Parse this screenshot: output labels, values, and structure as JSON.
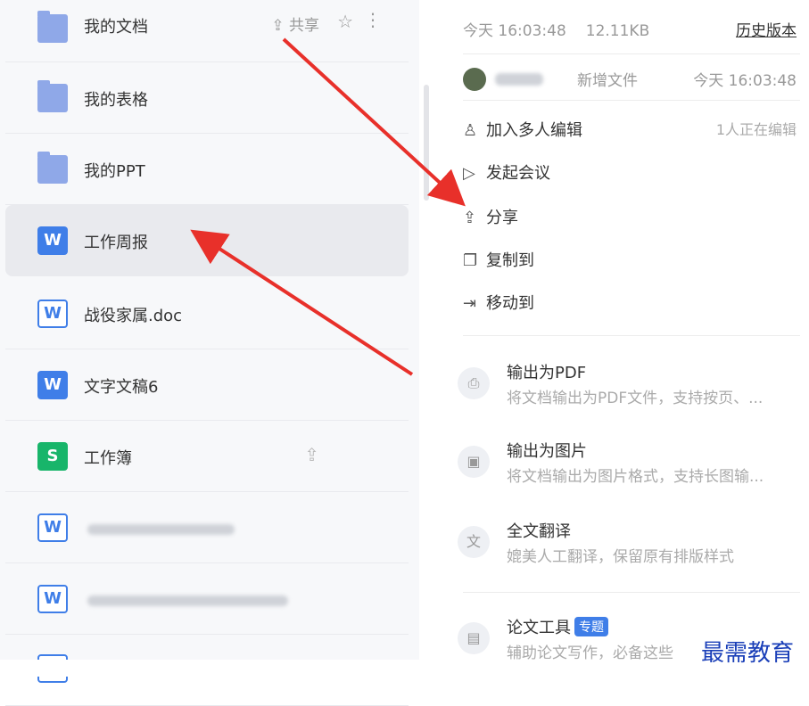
{
  "files": [
    {
      "name": "我的文档",
      "type": "folder",
      "share_label": "共享"
    },
    {
      "name": "我的表格",
      "type": "folder"
    },
    {
      "name": "我的PPT",
      "type": "folder"
    },
    {
      "name": "工作周报",
      "type": "word-fill",
      "icon_letter": "W"
    },
    {
      "name": "战役家属.doc",
      "type": "word-outline",
      "icon_letter": "W"
    },
    {
      "name": "文字文稿6",
      "type": "word-fill",
      "icon_letter": "W"
    },
    {
      "name": "工作簿",
      "type": "sheet",
      "icon_letter": "S"
    },
    {
      "name": "",
      "type": "word-outline",
      "icon_letter": "W"
    },
    {
      "name": "",
      "type": "word-outline",
      "icon_letter": "W"
    }
  ],
  "detail": {
    "modified": "今天 16:03:48",
    "size": "12.11KB",
    "history": "历史版本",
    "activity_action": "新增文件",
    "activity_time": "今天 16:03:48",
    "editing_status": "1人正在编辑"
  },
  "menu": [
    {
      "label": "加入多人编辑",
      "icon": "add-user-icon"
    },
    {
      "label": "发起会议",
      "icon": "meeting-icon"
    },
    {
      "label": "分享",
      "icon": "share-icon"
    },
    {
      "label": "复制到",
      "icon": "copy-icon"
    },
    {
      "label": "移动到",
      "icon": "move-icon"
    }
  ],
  "tools": [
    {
      "title": "输出为PDF",
      "desc": "将文档输出为PDF文件，支持按页、...",
      "icon": "pdf-icon"
    },
    {
      "title": "输出为图片",
      "desc": "将文档输出为图片格式，支持长图输...",
      "icon": "image-icon"
    },
    {
      "title": "全文翻译",
      "desc": "媲美人工翻译，保留原有排版样式",
      "icon": "translate-icon"
    },
    {
      "title": "论文工具",
      "badge": "专题",
      "desc": "辅助论文写作，必备这些",
      "icon": "paper-icon"
    }
  ],
  "watermark": "最需教育",
  "colors": {
    "accent": "#3f7ee8",
    "sheet": "#18b56a",
    "arrow": "#e8302a"
  }
}
